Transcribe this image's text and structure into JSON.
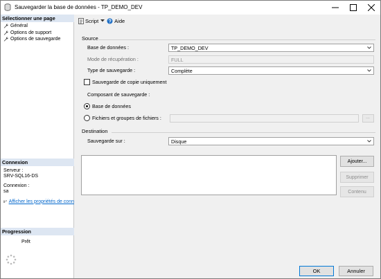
{
  "window": {
    "title": "Sauvegarder la base de données - TP_DEMO_DEV"
  },
  "left_panel": {
    "select_page_header": "Sélectionner une page",
    "pages": [
      {
        "label": "Général",
        "icon": "wrench-icon"
      },
      {
        "label": "Options de support",
        "icon": "wrench-icon"
      },
      {
        "label": "Options de sauvegarde",
        "icon": "wrench-icon"
      }
    ],
    "connection_header": "Connexion",
    "server_label": "Serveur :",
    "server_value": "SRV-SQL16-DS",
    "connection_label": "Connexion :",
    "connection_value": "sa",
    "view_properties_link": "Afficher les propriétés de conn",
    "progress_header": "Progression",
    "progress_status": "Prêt"
  },
  "toolbar": {
    "script_label": "Script",
    "help_label": "Aide"
  },
  "source": {
    "header": "Source",
    "database_label": "Base de données :",
    "database_value": "TP_DEMO_DEV",
    "recovery_model_label": "Mode de récupération :",
    "recovery_model_value": "FULL",
    "backup_type_label": "Type de sauvegarde :",
    "backup_type_value": "Complète",
    "copy_only_label": "Sauvegarde de copie uniquement",
    "copy_only_checked": false,
    "component_label": "Composant de sauvegarde :",
    "component_database_label": "Base de données",
    "component_files_label": "Fichiers et groupes de fichiers :",
    "component_selected": "database",
    "browse_button": "..."
  },
  "destination": {
    "header": "Destination",
    "backup_to_label": "Sauvegarde sur :",
    "backup_to_value": "Disque",
    "add_button": "Ajouter...",
    "remove_button": "Supprimer",
    "contents_button": "Contenu"
  },
  "footer": {
    "ok_button": "OK",
    "cancel_button": "Annuler"
  }
}
